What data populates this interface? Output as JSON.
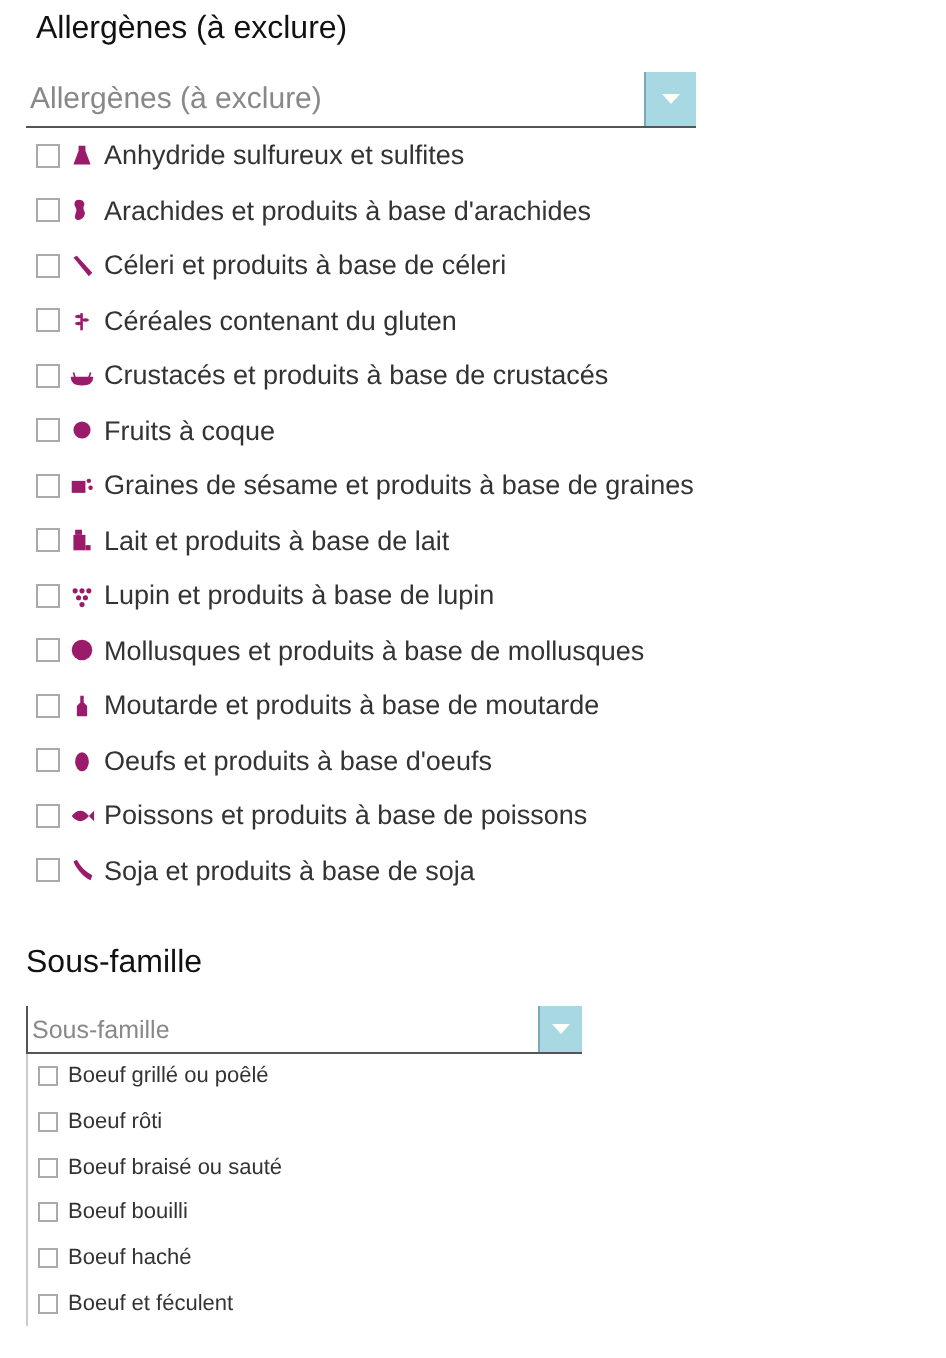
{
  "allergens": {
    "title": "Allergènes (à exclure)",
    "placeholder": "Allergènes (à exclure)",
    "items": [
      {
        "label": "Anhydride sulfureux et sulfites",
        "checked": false
      },
      {
        "label": "Arachides et produits à base d'arachides",
        "checked": false
      },
      {
        "label": "Céleri et produits à base de céleri",
        "checked": false
      },
      {
        "label": "Céréales contenant du gluten",
        "checked": false
      },
      {
        "label": "Crustacés et produits à base de crustacés",
        "checked": false
      },
      {
        "label": "Fruits à coque",
        "checked": false
      },
      {
        "label": "Graines de sésame et produits à base de graines",
        "checked": false
      },
      {
        "label": "Lait et produits à base de lait",
        "checked": false
      },
      {
        "label": "Lupin et produits à base de lupin",
        "checked": false
      },
      {
        "label": "Mollusques et produits à base de mollusques",
        "checked": false
      },
      {
        "label": "Moutarde et produits à base de moutarde",
        "checked": false
      },
      {
        "label": "Oeufs et produits à base d'oeufs",
        "checked": false
      },
      {
        "label": "Poissons et produits à base de poissons",
        "checked": false
      },
      {
        "label": "Soja et produits à base de soja",
        "checked": false
      }
    ]
  },
  "subfamily": {
    "title": "Sous-famille",
    "placeholder": "Sous-famille",
    "items": [
      {
        "label": "Boeuf grillé ou poêlé",
        "checked": false
      },
      {
        "label": "Boeuf rôti",
        "checked": false
      },
      {
        "label": "Boeuf braisé ou sauté",
        "checked": false
      },
      {
        "label": "Boeuf bouilli",
        "checked": false
      },
      {
        "label": "Boeuf haché",
        "checked": false
      },
      {
        "label": "Boeuf et féculent",
        "checked": false
      }
    ]
  }
}
